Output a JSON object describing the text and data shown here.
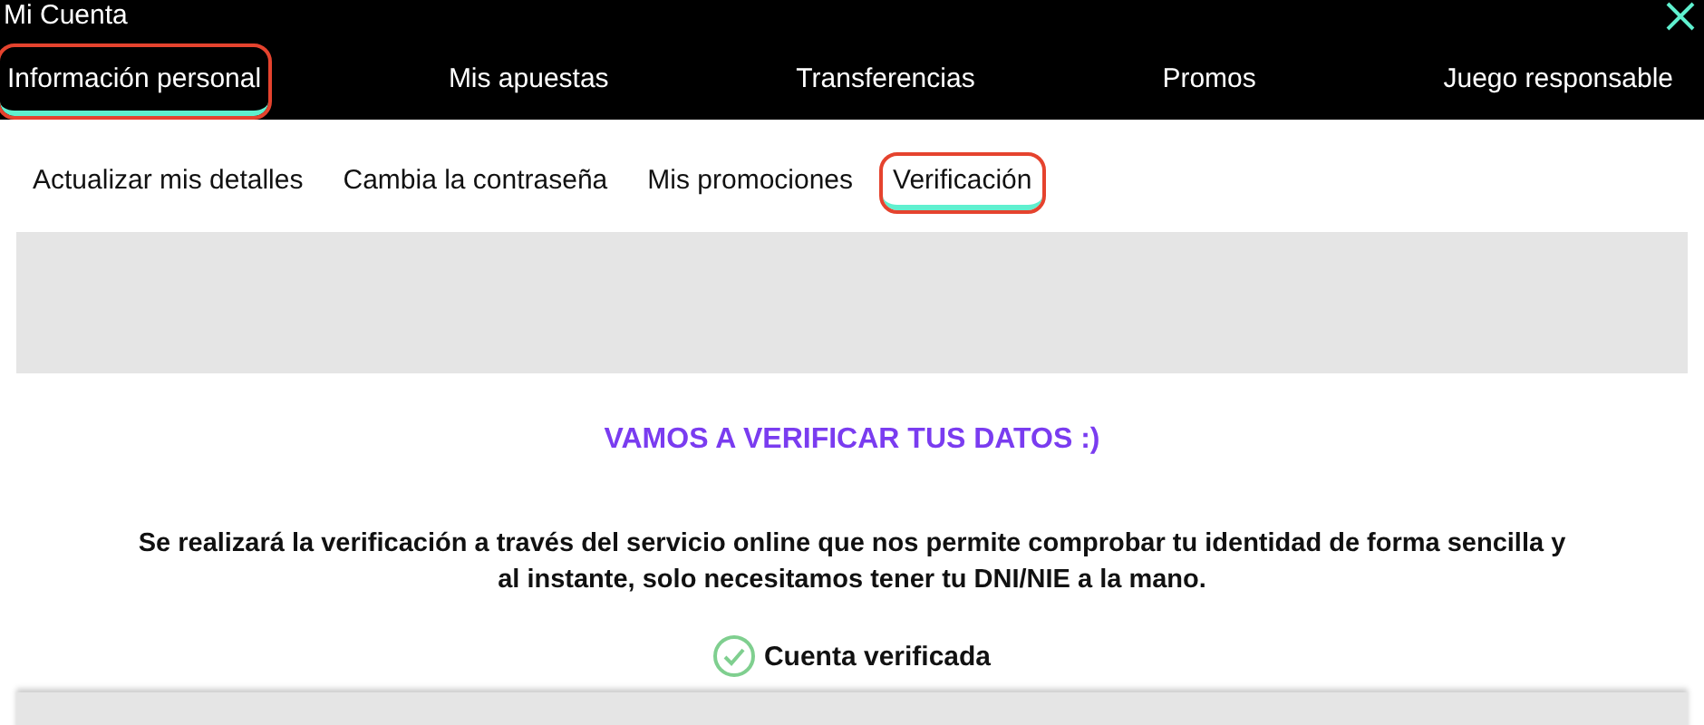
{
  "window": {
    "title": "Mi Cuenta"
  },
  "tabs": [
    {
      "label": "Información personal",
      "selected": true,
      "highlighted": true
    },
    {
      "label": "Mis apuestas",
      "selected": false,
      "highlighted": false
    },
    {
      "label": "Transferencias",
      "selected": false,
      "highlighted": false
    },
    {
      "label": "Promos",
      "selected": false,
      "highlighted": false
    },
    {
      "label": "Juego responsable",
      "selected": false,
      "highlighted": false
    }
  ],
  "subtabs": [
    {
      "label": "Actualizar mis detalles",
      "selected": false,
      "highlighted": false
    },
    {
      "label": "Cambia la contraseña",
      "selected": false,
      "highlighted": false
    },
    {
      "label": "Mis promociones",
      "selected": false,
      "highlighted": false
    },
    {
      "label": "Verificación",
      "selected": true,
      "highlighted": true
    }
  ],
  "verification": {
    "heading": "VAMOS A VERIFICAR TUS DATOS :)",
    "description": "Se realizará la verificación a través del servicio online que nos permite comprobar tu identidad de forma sencilla y al instante, solo necesitamos tener tu DNI/NIE a la mano.",
    "verified": true,
    "status": "Cuenta verificada"
  }
}
